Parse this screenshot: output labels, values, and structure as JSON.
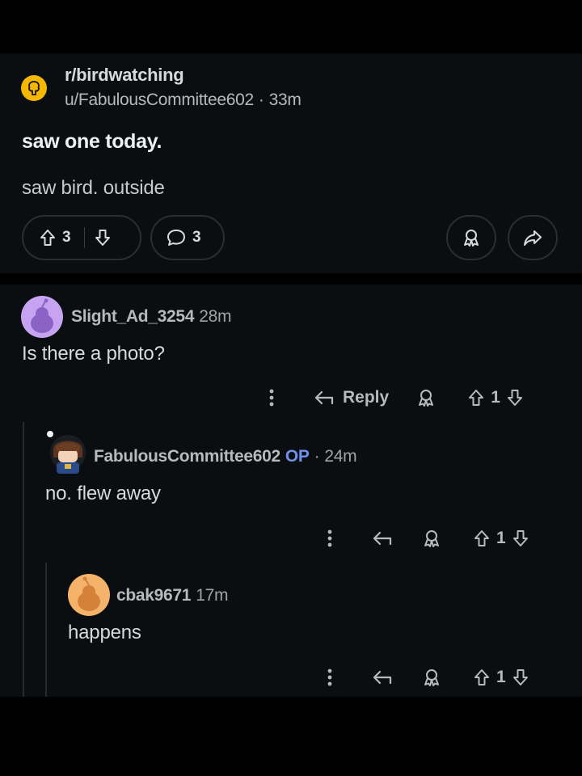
{
  "post": {
    "subreddit": "r/birdwatching",
    "author": "u/FabulousCommittee602",
    "separator": "·",
    "age": "33m",
    "title": "saw one today.",
    "body": "saw bird. outside",
    "upvotes": "3",
    "comments_count": "3"
  },
  "comments": [
    {
      "username": "Slight_Ad_3254",
      "age": "28m",
      "text": "Is there a photo?",
      "reply_label": "Reply",
      "votes": "1"
    },
    {
      "username": "FabulousCommittee602",
      "op_badge": "OP",
      "separator": "·",
      "age": "24m",
      "text": "no. flew away",
      "votes": "1"
    },
    {
      "username": "cbak9671",
      "age": "17m",
      "text": "happens",
      "votes": "1"
    }
  ],
  "icons": [
    "tree-icon",
    "upvote-icon",
    "downvote-icon",
    "comment-icon",
    "award-icon",
    "share-icon",
    "more-icon",
    "reply-icon",
    "avatar"
  ],
  "colors": {
    "background": "#0b0e11",
    "op_badge": "#6f8fe8",
    "subreddit_avatar": "#f5b800"
  }
}
